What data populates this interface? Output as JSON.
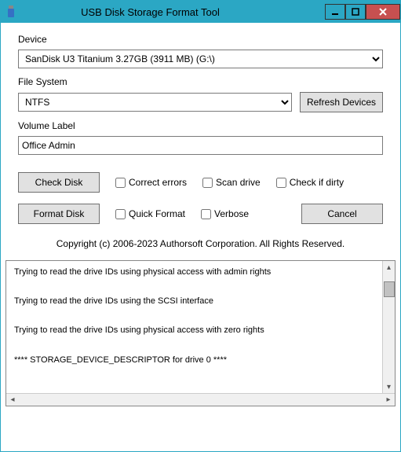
{
  "window": {
    "title": "USB Disk Storage Format Tool",
    "icon": "usb-drive"
  },
  "labels": {
    "device": "Device",
    "filesystem": "File System",
    "volume": "Volume Label"
  },
  "device": {
    "selected": "SanDisk U3 Titanium 3.27GB (3911 MB)  (G:\\)"
  },
  "filesystem": {
    "selected": "NTFS"
  },
  "volume": {
    "value": "Office Admin"
  },
  "buttons": {
    "refresh": "Refresh Devices",
    "check": "Check Disk",
    "format": "Format Disk",
    "cancel": "Cancel"
  },
  "checkboxes": {
    "correct": "Correct errors",
    "scan": "Scan drive",
    "dirty": "Check if dirty",
    "quick": "Quick Format",
    "verbose": "Verbose"
  },
  "copyright": "Copyright (c) 2006-2023 Authorsoft Corporation. All Rights Reserved.",
  "log": {
    "lines": [
      "Trying to read the drive IDs using physical access with admin rights",
      "Trying to read the drive IDs using the SCSI interface",
      "Trying to read the drive IDs using physical access with zero rights",
      "**** STORAGE_DEVICE_DESCRIPTOR for drive 0 ****"
    ]
  }
}
